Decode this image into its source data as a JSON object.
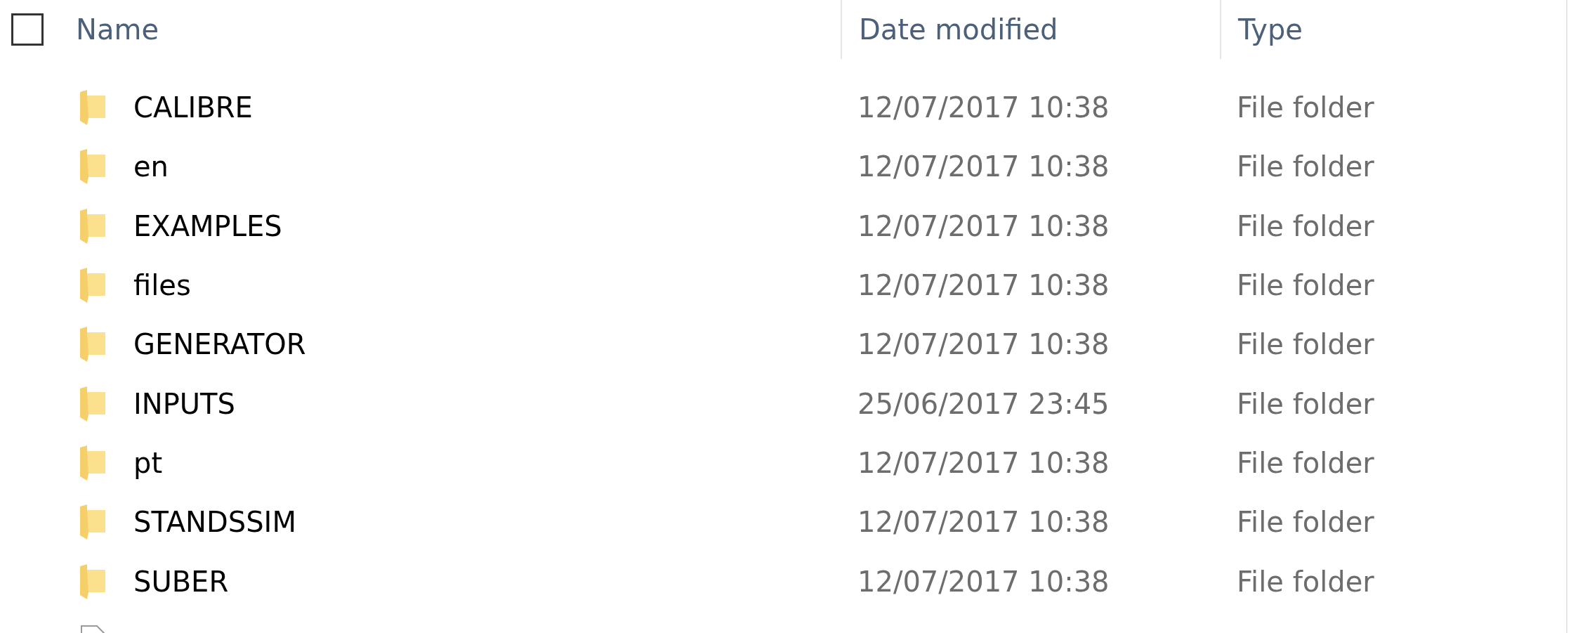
{
  "header": {
    "select_all": {
      "checked": false
    },
    "columns": [
      "Name",
      "Date modified",
      "Type"
    ]
  },
  "rows": [
    {
      "kind": "folder",
      "name": "CALIBRE",
      "date": "12/07/2017 10:38",
      "type": "File folder"
    },
    {
      "kind": "folder",
      "name": "en",
      "date": "12/07/2017 10:38",
      "type": "File folder"
    },
    {
      "kind": "folder",
      "name": "EXAMPLES",
      "date": "12/07/2017 10:38",
      "type": "File folder"
    },
    {
      "kind": "folder",
      "name": "files",
      "date": "12/07/2017 10:38",
      "type": "File folder"
    },
    {
      "kind": "folder",
      "name": "GENERATOR",
      "date": "12/07/2017 10:38",
      "type": "File folder"
    },
    {
      "kind": "folder",
      "name": "INPUTS",
      "date": "25/06/2017 23:45",
      "type": "File folder"
    },
    {
      "kind": "folder",
      "name": "pt",
      "date": "12/07/2017 10:38",
      "type": "File folder"
    },
    {
      "kind": "folder",
      "name": "STANDSSIM",
      "date": "12/07/2017 10:38",
      "type": "File folder"
    },
    {
      "kind": "folder",
      "name": "SUBER",
      "date": "12/07/2017 10:38",
      "type": "File folder"
    },
    {
      "kind": "file"
    }
  ]
}
